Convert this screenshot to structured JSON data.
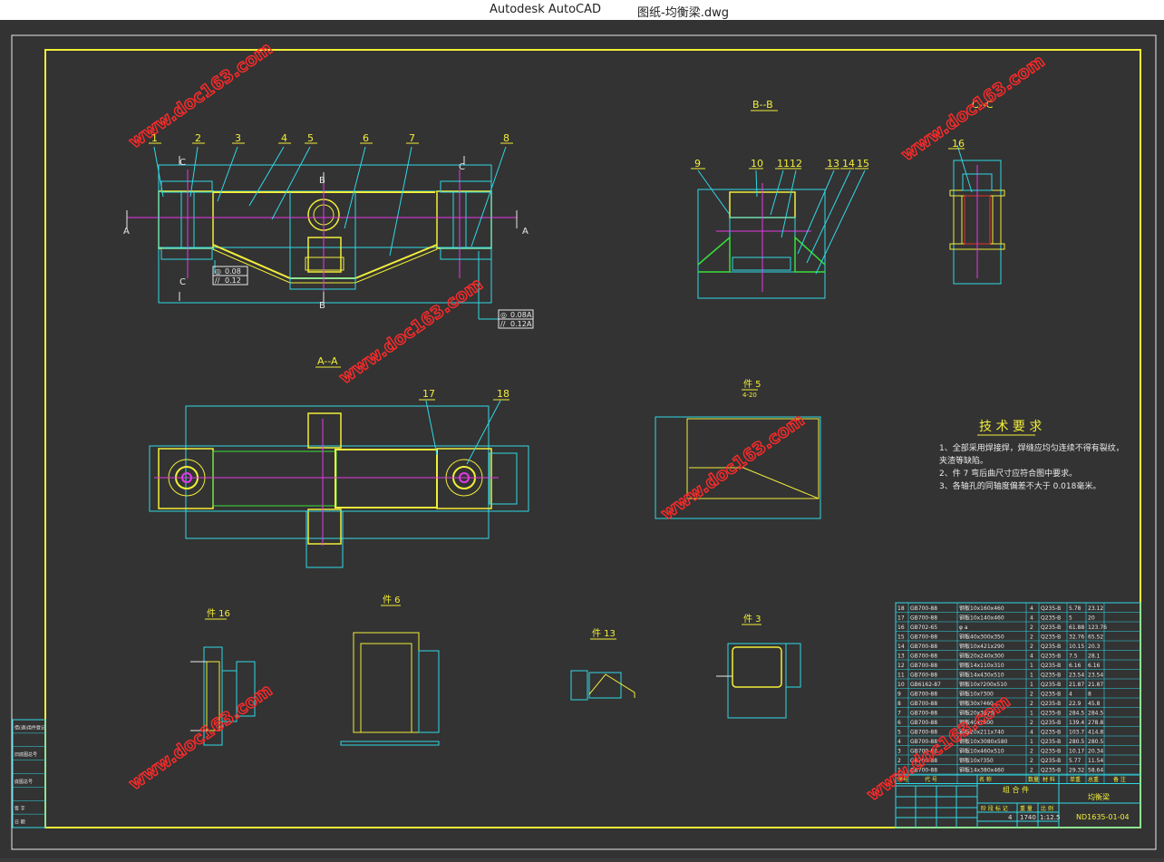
{
  "window": {
    "app_name": "Autodesk AutoCAD",
    "file_name": "图纸-均衡梁.dwg"
  },
  "colors": {
    "cyan": "#2fd8e6",
    "yellow": "#f2ee3a",
    "magenta": "#e43ae6",
    "green": "#39e039",
    "white": "#e8e8e8",
    "red": "#e03030",
    "watermark": "#ff2a2a"
  },
  "watermark": "www.doc163.com",
  "views": {
    "bb": "B--B",
    "cc": "C--C",
    "aa": "A--A",
    "part5": "件 5",
    "part5_scale": "4-20",
    "part16": "件 16",
    "part6": "件 6",
    "part13": "件 13",
    "part3": "件 3"
  },
  "balloons_main": [
    "1",
    "2",
    "3",
    "4",
    "5",
    "6",
    "7",
    "8"
  ],
  "balloons_bb": [
    "9",
    "10",
    "11",
    "12",
    "13",
    "14",
    "15"
  ],
  "balloon_cc": "16",
  "balloons_aa": [
    "17",
    "18"
  ],
  "section_marks": {
    "a": "A",
    "b": "B",
    "c": "C"
  },
  "tolerances": [
    {
      "sym": "◎",
      "val": "0.08",
      "ref": "A"
    },
    {
      "sym": "//",
      "val": "0.12",
      "ref": "A"
    }
  ],
  "tech": {
    "title": "技 术 要 求",
    "items": [
      "1、全部采用焊接焊，焊缝应均匀连续不得有裂纹，",
      "    夹渣等缺陷。",
      "2、件 7 弯后曲尺寸应符合图中要求。",
      "3、各轴孔的同轴度偏差不大于 0.018毫米。"
    ]
  },
  "bom": [
    [
      "18",
      "GB700-88",
      "钢板10x160x460",
      "4",
      "Q235-B",
      "5.78",
      "23.12"
    ],
    [
      "17",
      "GB700-88",
      "钢板10x140x460",
      "4",
      "Q235-B",
      "5",
      "20"
    ],
    [
      "16",
      "GB702-65",
      "φ a",
      "2",
      "Q235-B",
      "61.88",
      "123.76"
    ],
    [
      "15",
      "GB700-88",
      "钢板40x300x350",
      "2",
      "Q235-B",
      "32.76",
      "65.52"
    ],
    [
      "14",
      "GB700-88",
      "钢板10x421x290",
      "2",
      "Q235-B",
      "10.15",
      "20.3"
    ],
    [
      "13",
      "GB700-88",
      "钢板20x240x300",
      "4",
      "Q235-B",
      "7.5",
      "28.1"
    ],
    [
      "12",
      "GB700-88",
      "钢板14x110x310",
      "1",
      "Q235-B",
      "6.16",
      "6.16"
    ],
    [
      "11",
      "GB700-88",
      "钢板14x430x510",
      "1",
      "Q235-B",
      "23.54",
      "23.54"
    ],
    [
      "10",
      "GB6162-87",
      "钢板10x?200x510",
      "1",
      "Q235-B",
      "21.87",
      "21.87"
    ],
    [
      "9",
      "GB700-88",
      "钢板10x?300",
      "2",
      "Q235-B",
      "4",
      "8"
    ],
    [
      "8",
      "GB700-88",
      "钢板30x?460",
      "2",
      "Q235-B",
      "22.9",
      "45.8"
    ],
    [
      "7",
      "GB700-88",
      "钢板20x3176",
      "1",
      "Q235-B",
      "284.5",
      "284.5"
    ],
    [
      "6",
      "GB700-88",
      "钢板40x?400",
      "2",
      "Q235-B",
      "139.4",
      "278.8"
    ],
    [
      "5",
      "GB700-88",
      "钢板20x211x740",
      "4",
      "Q235-B",
      "103.7",
      "414.8"
    ],
    [
      "4",
      "GB700-88",
      "钢板10x3080x580",
      "1",
      "Q235-B",
      "280.5",
      "280.5"
    ],
    [
      "3",
      "GB700-88",
      "钢板10x460x510",
      "2",
      "Q235-B",
      "10.17",
      "20.34"
    ],
    [
      "2",
      "GB700-88",
      "钢板10x?350",
      "2",
      "Q235-B",
      "5.77",
      "11.54"
    ],
    [
      "1",
      "GB700-88",
      "钢板14x380x460",
      "2",
      "Q235-B",
      "29.32",
      "58.64"
    ]
  ],
  "bom_header": [
    "序号",
    "代 号",
    "名 称",
    "数量",
    "材 料",
    "单重",
    "总重",
    "备 注"
  ],
  "title_block": {
    "assembly": "组 合 件",
    "part_name": "均衡梁",
    "drawing_no": "ND1635-01-04",
    "qty": "4",
    "weight": "1740",
    "scale": "1:12.5",
    "stage": "阶 段 标 记",
    "weight_label": "重 量",
    "scale_label": "比 例"
  },
  "left_block": [
    "借(通)用件登记",
    "",
    "旧底图总号",
    "",
    "底图总号",
    "",
    "签 字",
    "日 期"
  ]
}
